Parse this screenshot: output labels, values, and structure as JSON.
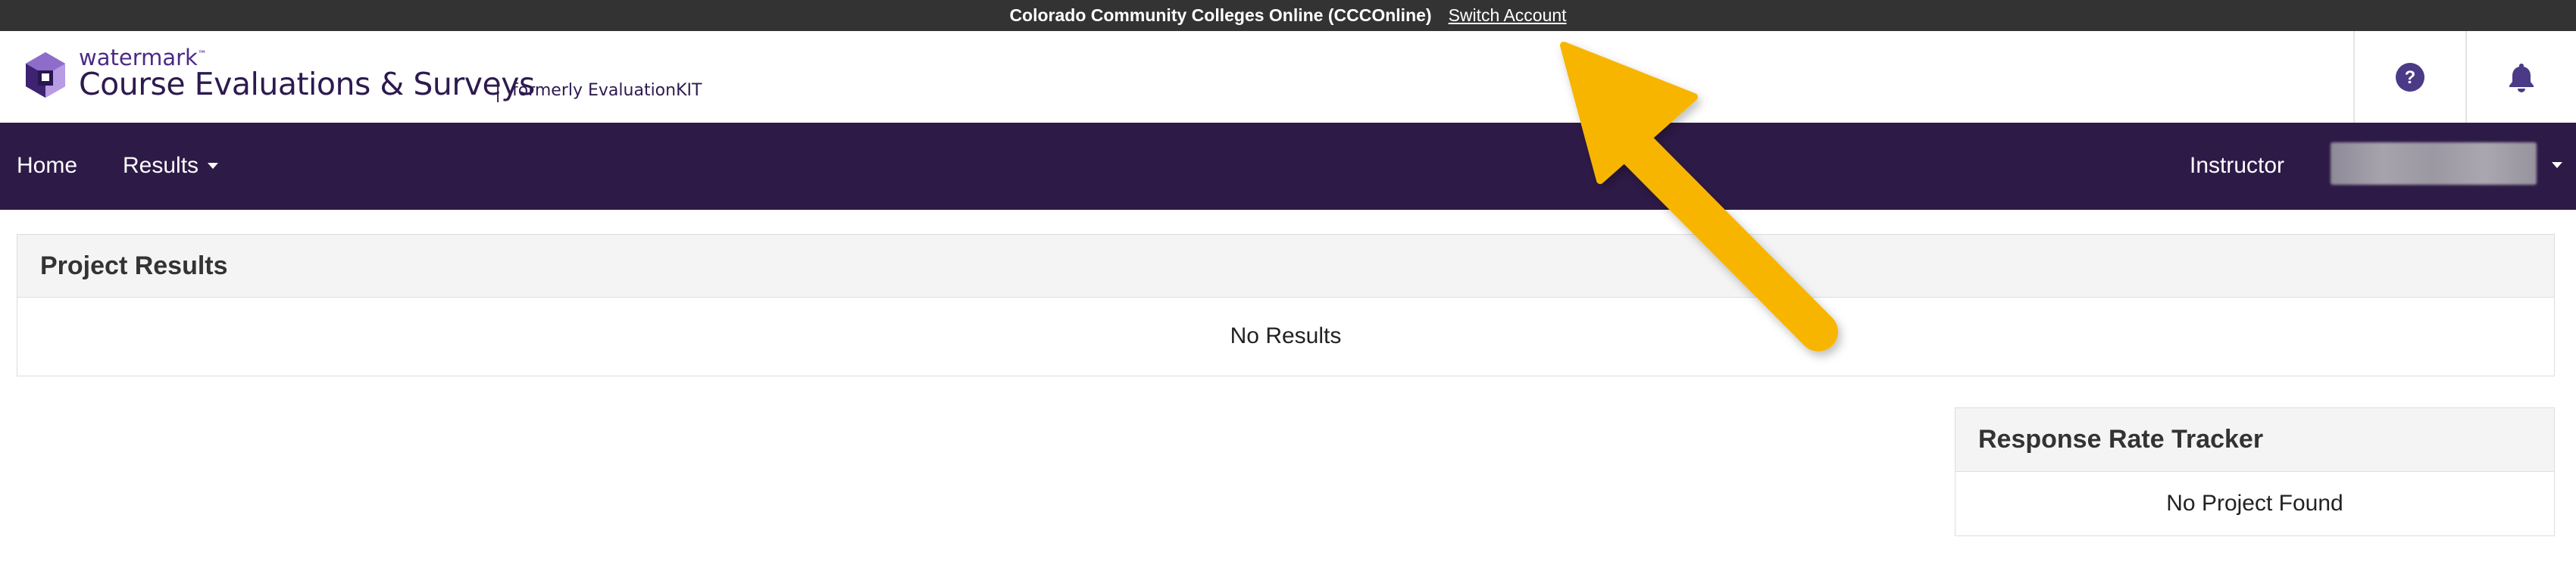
{
  "account_bar": {
    "institution": "Colorado Community Colleges Online (CCCOnline)",
    "switch_label": "Switch Account"
  },
  "header": {
    "brand_small": "watermark",
    "brand_tm": "™",
    "brand_main": "Course Evaluations & Surveys",
    "separator": "|",
    "formerly": "formerly EvaluationKIT",
    "help_icon": "question-circle-icon",
    "bell_icon": "bell-icon"
  },
  "nav": {
    "home": "Home",
    "results": "Results",
    "role": "Instructor"
  },
  "project_results": {
    "title": "Project Results",
    "empty": "No Results"
  },
  "response_rate": {
    "title": "Response Rate Tracker",
    "empty": "No Project Found"
  },
  "colors": {
    "account_bar": "#333333",
    "navbar": "#2e1a47",
    "brand": "#4b2a87",
    "annotation_arrow": "#f7b500"
  }
}
